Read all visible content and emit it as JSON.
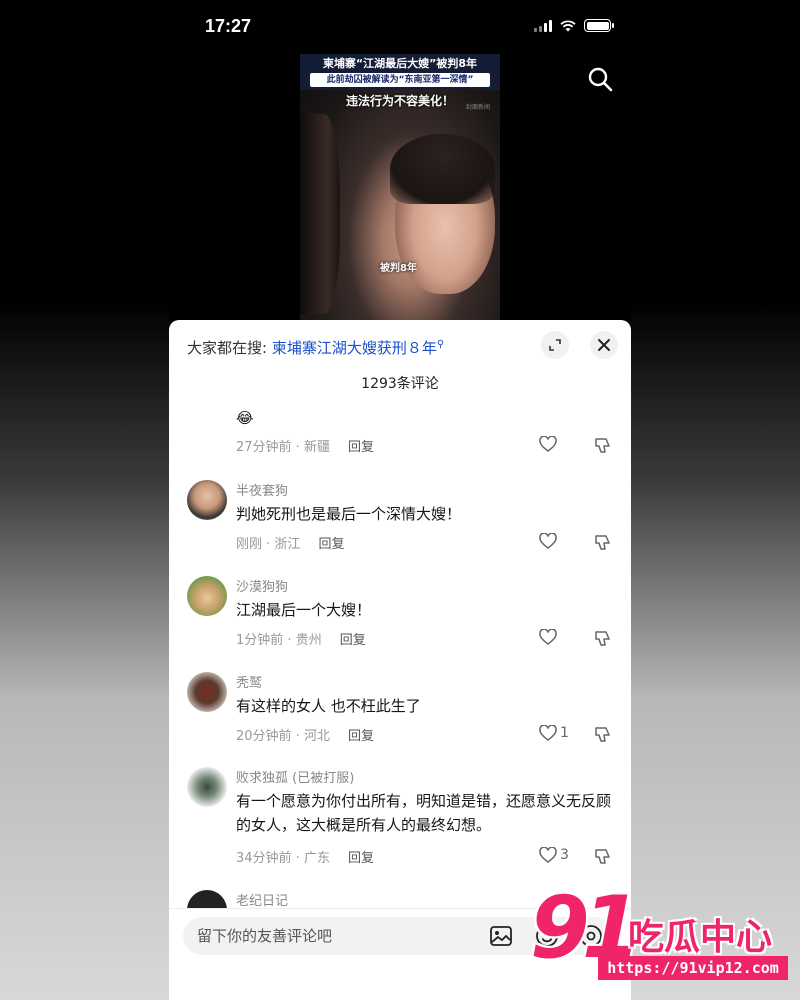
{
  "status_bar": {
    "time": "17:27",
    "battery_level": 1.0
  },
  "video": {
    "headline_line1": "柬埔寨“江湖最后大嫂”被判8年",
    "headline_line2": "此前劫囚被解读为“东南亚第一深情”",
    "headline_line3": "违法行为不容美化！",
    "caption": "被判8年",
    "watermark": "封面新闻"
  },
  "sheet": {
    "hot_search_prefix": "大家都在搜: ",
    "hot_search_term": "柬埔寨江湖大嫂获刑８年",
    "comment_count": "1293条评论"
  },
  "comments": [
    {
      "username": "",
      "text": "😂",
      "time": "27分钟前",
      "location": "新疆",
      "reply": "回复",
      "likes": ""
    },
    {
      "username": "半夜套狗",
      "text": "判她死刑也是最后一个深情大嫂！",
      "time": "刚刚",
      "location": "浙江",
      "reply": "回复",
      "likes": ""
    },
    {
      "username": "沙漠狗狗",
      "text": "江湖最后一个大嫂！",
      "time": "1分钟前",
      "location": "贵州",
      "reply": "回复",
      "likes": ""
    },
    {
      "username": "秃鹫",
      "text": "有这样的女人 也不枉此生了",
      "time": "20分钟前",
      "location": "河北",
      "reply": "回复",
      "likes": "1"
    },
    {
      "username": "败求独孤 (已被打服)",
      "text": "有一个愿意为你付出所有，明知道是错，还愿意义无反顾的女人，这大概是所有人的最终幻想。",
      "time": "34分钟前",
      "location": "广东",
      "reply": "回复",
      "likes": "3"
    },
    {
      "username": "老纪日记",
      "text": "",
      "time": "",
      "location": "",
      "reply": "",
      "likes": ""
    }
  ],
  "input": {
    "placeholder": "留下你的友善评论吧"
  },
  "site_watermark": {
    "number": "91",
    "text": "吃瓜中心",
    "url": "https://91vip12.com"
  }
}
